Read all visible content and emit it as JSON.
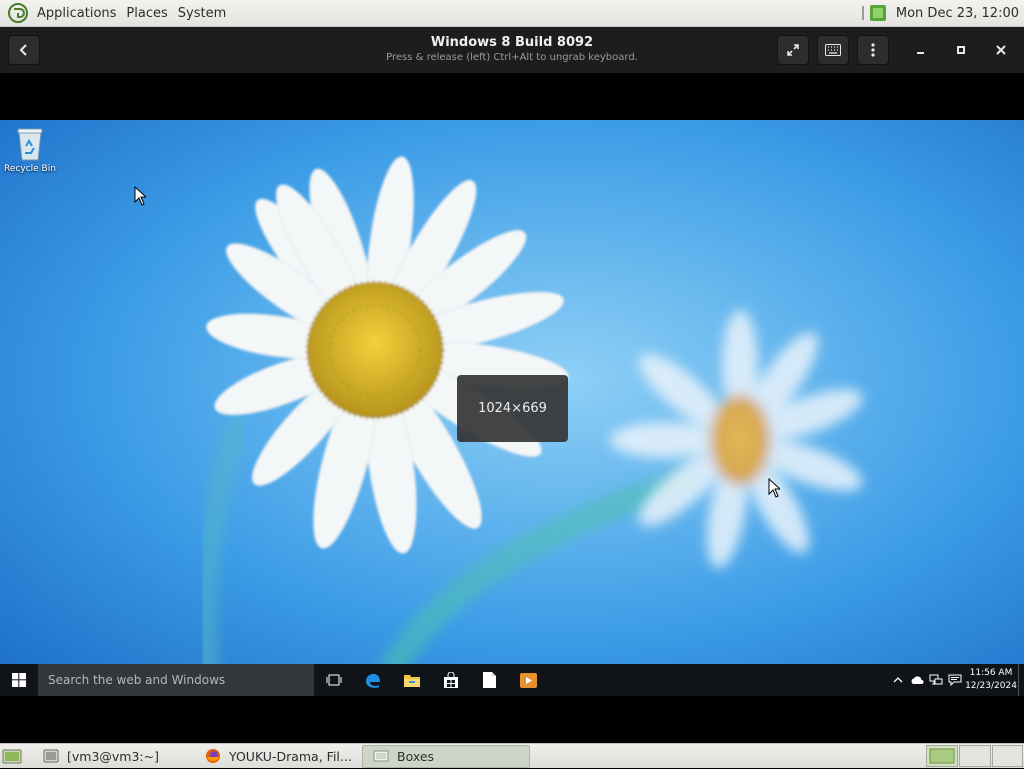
{
  "top_panel": {
    "menus": [
      "Applications",
      "Places",
      "System"
    ],
    "clock": "Mon Dec 23, 12:00"
  },
  "boxes": {
    "title": "Windows 8 Build 8092",
    "subtitle": "Press & release (left) Ctrl+Alt to ungrab keyboard."
  },
  "guest": {
    "desktop_icons": [
      {
        "label": "Recycle Bin",
        "icon": "recycle-bin-icon"
      }
    ],
    "resolution_osd": "1024×669",
    "taskbar": {
      "search_placeholder": "Search the web and Windows",
      "apps": [
        "task-view-icon",
        "edge-icon",
        "file-explorer-icon",
        "store-icon",
        "notepad-icon",
        "media-player-icon"
      ],
      "time": "11:56 AM",
      "date": "12/23/2024"
    }
  },
  "bottom_panel": {
    "tasks": [
      {
        "label": "[vm3@vm3:~]",
        "icon": "terminal-icon",
        "active": false
      },
      {
        "label": "YOUKU-Drama, Fil...",
        "icon": "firefox-icon",
        "active": false
      },
      {
        "label": "Boxes",
        "icon": "boxes-icon",
        "active": true
      }
    ]
  },
  "colors": {
    "sky": "#2f8fe0",
    "taskbar": "#101318",
    "headerbar": "#1d1d1d",
    "panel": "#e8e8e4"
  }
}
